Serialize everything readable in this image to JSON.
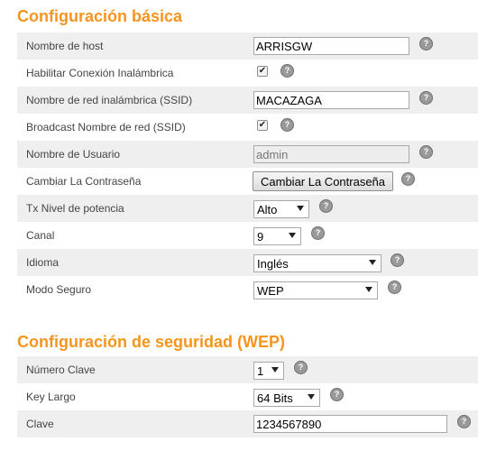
{
  "basic": {
    "title": "Configuración básica",
    "hostname": {
      "label": "Nombre de host",
      "value": "ARRISGW"
    },
    "wireless_enable": {
      "label": "Habilitar Conexión Inalámbrica",
      "checked": true
    },
    "ssid": {
      "label": "Nombre de red inalámbrica (SSID)",
      "value": "MACAZAGA"
    },
    "broadcast_ssid": {
      "label": "Broadcast Nombre de red (SSID)",
      "checked": true
    },
    "username": {
      "label": "Nombre de Usuario",
      "value": "admin"
    },
    "password": {
      "label": "Cambiar La Contraseña",
      "button": "Cambiar La Contraseña"
    },
    "tx_power": {
      "label": "Tx Nivel de potencia",
      "value": "Alto"
    },
    "channel": {
      "label": "Canal",
      "value": "9"
    },
    "language": {
      "label": "Idioma",
      "value": "Inglés"
    },
    "security_mode": {
      "label": "Modo Seguro",
      "value": "WEP"
    }
  },
  "wep": {
    "title": "Configuración de seguridad (WEP)",
    "key_number": {
      "label": "Número Clave",
      "value": "1"
    },
    "key_length": {
      "label": "Key Largo",
      "value": "64 Bits"
    },
    "key": {
      "label": "Clave",
      "value": "1234567890"
    }
  },
  "help_glyph": "?",
  "check_glyph": "✔",
  "icons": {
    "help": "help-icon",
    "dropdown": "chevron-down-icon"
  },
  "colors": {
    "title": "#f7941d",
    "row_shade": "#efefef"
  }
}
